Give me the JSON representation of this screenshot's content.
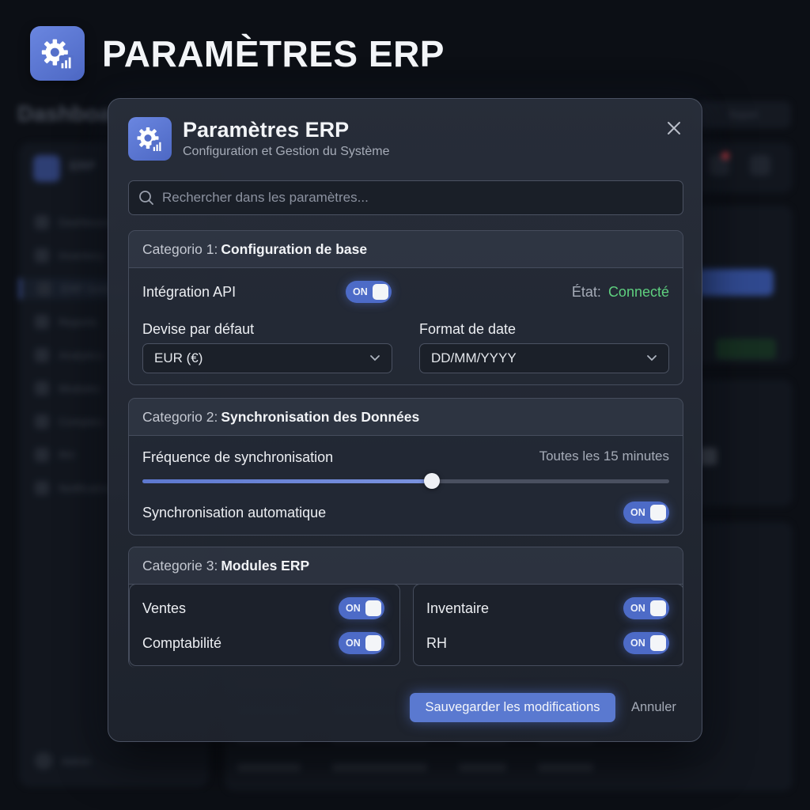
{
  "page": {
    "title": "PARAMÈTRES ERP"
  },
  "modal": {
    "title": "Paramètres ERP",
    "subtitle": "Configuration et Gestion du Système",
    "search_placeholder": "Rechercher dans les paramètres..."
  },
  "sections": {
    "base": {
      "prefix": "Categorio 1:",
      "name": "Configuration de base",
      "api_label": "Intégration API",
      "api_toggle": "ON",
      "status_label": "État:",
      "status_value": "Connecté",
      "status_color": "#5fd07f",
      "currency_label": "Devise par défaut",
      "currency_value": "EUR (€)",
      "date_label": "Format de date",
      "date_value": "DD/MM/YYYY"
    },
    "sync": {
      "prefix": "Categorio 2:",
      "name": "Synchronisation des Données",
      "freq_label": "Fréquence de synchronisation",
      "freq_value": "Toutes les 15 minutes",
      "slider_fraction": 0.55,
      "auto_label": "Synchronisation automatique",
      "auto_toggle": "ON"
    },
    "modules": {
      "prefix": "Categorie 3:",
      "name": "Modules ERP",
      "items": [
        {
          "label": "Ventes",
          "toggle": "ON"
        },
        {
          "label": "Comptabilité",
          "toggle": "ON"
        },
        {
          "label": "Inventaire",
          "toggle": "ON"
        },
        {
          "label": "RH",
          "toggle": "ON"
        }
      ]
    }
  },
  "actions": {
    "save": "Sauvegarder les modifications",
    "cancel": "Annuler"
  },
  "colors": {
    "accent": "#5a79d0",
    "background": "#0c0f15",
    "modal": "#262b36"
  }
}
